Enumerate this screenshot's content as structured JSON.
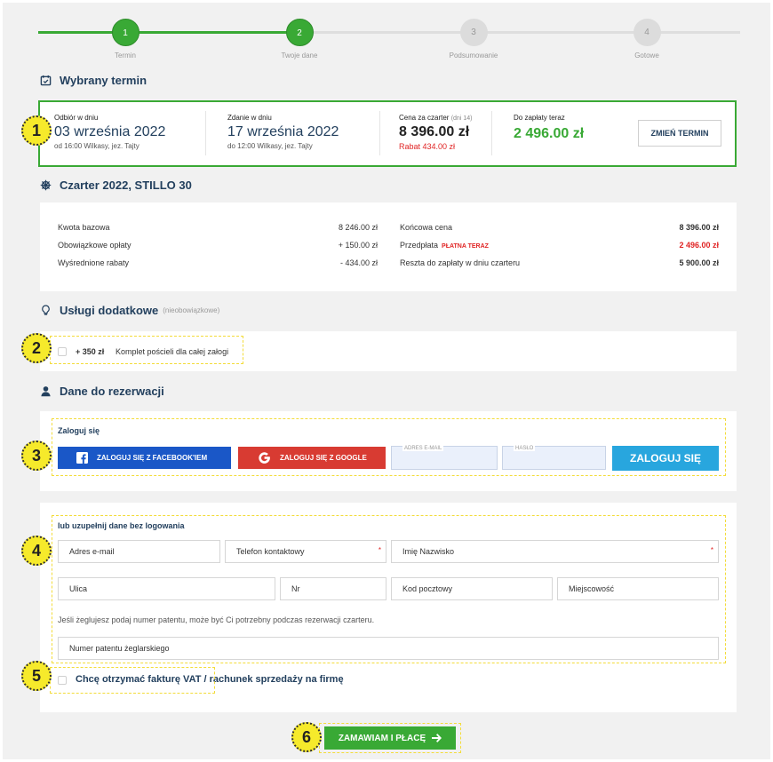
{
  "stepper": {
    "steps": [
      {
        "num": "1",
        "label": "Termin"
      },
      {
        "num": "2",
        "label": "Twoje dane"
      },
      {
        "num": "3",
        "label": "Podsumowanie"
      },
      {
        "num": "4",
        "label": "Gotowe"
      }
    ]
  },
  "term": {
    "title": "Wybrany termin",
    "pickup": {
      "label": "Odbiór w dniu",
      "date": "03 września 2022",
      "detail": "od 16:00  Wilkasy, jez. Tajty"
    },
    "return": {
      "label": "Zdanie w dniu",
      "date": "17 września 2022",
      "detail": "do 12:00  Wilkasy, jez. Tajty"
    },
    "price": {
      "label": "Cena za czarter",
      "days": "(dni 14)",
      "value": "8 396.00  zł",
      "discount": "Rabat 434.00  zł"
    },
    "pay_now": {
      "label": "Do zapłaty teraz",
      "value": "2 496.00  zł"
    },
    "change_button": "ZMIEŃ TERMIN"
  },
  "charter": {
    "title": "Czarter 2022, STILLO 30",
    "left": [
      {
        "label": "Kwota bazowa",
        "value": "8 246.00  zł"
      },
      {
        "label": "Obowiązkowe opłaty",
        "value": "+ 150.00  zł"
      },
      {
        "label": "Wyśrednione rabaty",
        "value": "- 434.00  zł"
      }
    ],
    "right": [
      {
        "label": "Końcowa cena",
        "value": "8 396.00  zł"
      },
      {
        "label": "Przedpłata",
        "badge": "PŁATNA TERAZ",
        "value": "2 496.00  zł"
      },
      {
        "label": "Reszta do zapłaty w dniu czarteru",
        "value": "5 900.00  zł"
      }
    ]
  },
  "services": {
    "title": "Usługi dodatkowe",
    "note": "(nieobowiązkowe)",
    "item_price": "+ 350 zł",
    "item_label": "Komplet pościeli dla całej załogi"
  },
  "reservation": {
    "title": "Dane do rezerwacji",
    "login_heading": "Zaloguj się",
    "facebook_button": "ZALOGUJ SIĘ Z FACEBOOK'IEM",
    "google_button": "ZALOGUJ SIĘ Z GOOGLE",
    "email_placeholder": "ADRES E-MAIL",
    "password_placeholder": "HASŁO",
    "login_button": "ZALOGUJ SIĘ",
    "guest_heading": "lub uzupełnij dane bez logowania",
    "fields": {
      "email": "Adres e-mail",
      "phone": "Telefon kontaktowy",
      "name": "Imię Nazwisko",
      "street": "Ulica",
      "nr": "Nr",
      "postal": "Kod pocztowy",
      "city": "Miejscowość",
      "patent": "Numer patentu żeglarskiego"
    },
    "patent_note": "Jeśli żeglujesz podaj numer patentu, może być Ci potrzebny podczas rezerwacji czarteru.",
    "invoice_label": "Chcę otrzymać fakturę VAT / rachunek sprzedaży na firmę"
  },
  "submit_button": "ZAMAWIAM I PŁACĘ",
  "markers": [
    "1",
    "2",
    "3",
    "4",
    "5",
    "6"
  ],
  "colors": {
    "accent": "#39a935",
    "navy": "#23405e",
    "red": "#e02424",
    "facebook": "#1a57c7",
    "google": "#d83b32",
    "login": "#28a6de",
    "marker": "#f6ea2b"
  }
}
